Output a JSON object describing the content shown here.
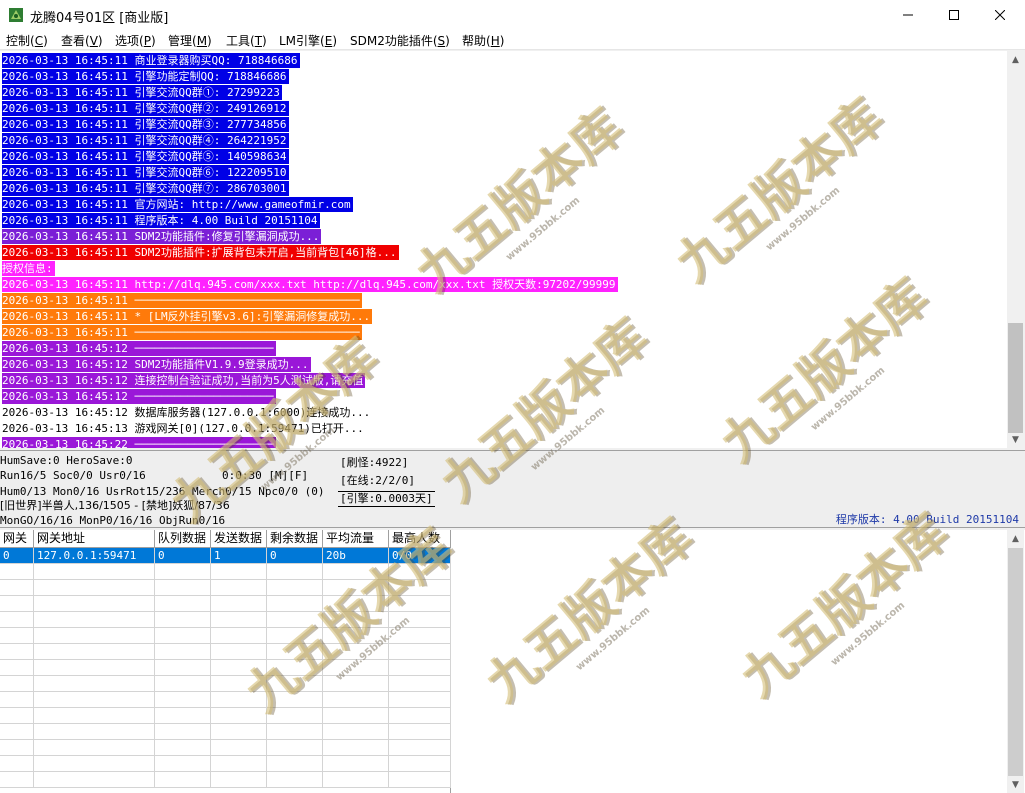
{
  "window": {
    "title": "龙腾04号01区 [商业版]"
  },
  "menu": [
    {
      "label": "控制(",
      "key": "C",
      "end": ")"
    },
    {
      "label": "查看(",
      "key": "V",
      "end": ")"
    },
    {
      "label": "选项(",
      "key": "P",
      "end": ")"
    },
    {
      "label": "管理(",
      "key": "M",
      "end": ")"
    },
    {
      "label": "工具(",
      "key": "T",
      "end": ")"
    },
    {
      "label": "LM引擎(",
      "key": "E",
      "end": ")"
    },
    {
      "label": "SDM2功能插件(",
      "key": "S",
      "end": ")"
    },
    {
      "label": "帮助(",
      "key": "H",
      "end": ")"
    }
  ],
  "colors": {
    "blue": "#0000e6",
    "purple": "#7b1fd6",
    "red": "#f00000",
    "magenta": "#ff22ff",
    "orange": "#ff7a0a",
    "violet": "#9a17d8",
    "selection": "#0078d7"
  },
  "log": [
    {
      "text": "2026-03-13 16:45:11 商业登录器购买QQ: 718846686",
      "bg": "#0000e6",
      "fg": "#ffffff"
    },
    {
      "text": "2026-03-13 16:45:11 引擎功能定制QQ: 718846686",
      "bg": "#0000e6",
      "fg": "#ffffff"
    },
    {
      "text": "2026-03-13 16:45:11 引擎交流QQ群①: 27299223",
      "bg": "#0000e6",
      "fg": "#ffffff"
    },
    {
      "text": "2026-03-13 16:45:11 引擎交流QQ群②: 249126912",
      "bg": "#0000e6",
      "fg": "#ffffff"
    },
    {
      "text": "2026-03-13 16:45:11 引擎交流QQ群③: 277734856",
      "bg": "#0000e6",
      "fg": "#ffffff"
    },
    {
      "text": "2026-03-13 16:45:11 引擎交流QQ群④: 264221952",
      "bg": "#0000e6",
      "fg": "#ffffff"
    },
    {
      "text": "2026-03-13 16:45:11 引擎交流QQ群⑤: 140598634",
      "bg": "#0000e6",
      "fg": "#ffffff"
    },
    {
      "text": "2026-03-13 16:45:11 引擎交流QQ群⑥: 122209510",
      "bg": "#0000e6",
      "fg": "#ffffff"
    },
    {
      "text": "2026-03-13 16:45:11 引擎交流QQ群⑦: 286703001",
      "bg": "#0000e6",
      "fg": "#ffffff"
    },
    {
      "text": "2026-03-13 16:45:11 官方网站: http://www.gameofmir.com",
      "bg": "#0000e6",
      "fg": "#ffffff"
    },
    {
      "text": "2026-03-13 16:45:11 程序版本: 4.00 Build 20151104",
      "bg": "#0000e6",
      "fg": "#ffffff"
    },
    {
      "text": "2026-03-13 16:45:11 SDM2功能插件:修复引擎漏洞成功...",
      "bg": "#7b1fd6",
      "fg": "#ffffff"
    },
    {
      "text": "2026-03-13 16:45:11 SDM2功能插件:扩展背包未开启,当前背包[46]格...",
      "bg": "#f00000",
      "fg": "#ffffff"
    },
    {
      "text": "授权信息:",
      "bg": "#ff22ff",
      "fg": "#ffffff"
    },
    {
      "text": "2026-03-13 16:45:11 http://dlq.945.com/xxx.txt http://dlq.945.com/xxx.txt 授权天数:97202/99999",
      "bg": "#ff22ff",
      "fg": "#ffffff"
    },
    {
      "text": "2026-03-13 16:45:11 ──────────────────────────────────",
      "bg": "#ff7a0a",
      "fg": "#ffffff"
    },
    {
      "text": "2026-03-13 16:45:11 * [LM反外挂引擎v3.6]:引擎漏洞修复成功...",
      "bg": "#ff7a0a",
      "fg": "#ffffff"
    },
    {
      "text": "2026-03-13 16:45:11 ──────────────────────────────────",
      "bg": "#ff7a0a",
      "fg": "#ffffff"
    },
    {
      "text": "2026-03-13 16:45:12 ─────────────────────",
      "bg": "#9a17d8",
      "fg": "#ffffff"
    },
    {
      "text": "2026-03-13 16:45:12 SDM2功能插件V1.9.9登录成功...",
      "bg": "#9a17d8",
      "fg": "#ffffff"
    },
    {
      "text": "2026-03-13 16:45:12 连接控制台验证成功,当前为5人测试版,请充值",
      "bg": "#9a17d8",
      "fg": "#ffffff"
    },
    {
      "text": "2026-03-13 16:45:12 ─────────────────────",
      "bg": "#9a17d8",
      "fg": "#ffffff"
    },
    {
      "text": "2026-03-13 16:45:12 数据库服务器(127.0.0.1:6000)连接成功...",
      "bg": "#ffffff",
      "fg": "#000000"
    },
    {
      "text": "2026-03-13 16:45:13 游戏网关[0](127.0.0.1:59471)已打开...",
      "bg": "#ffffff",
      "fg": "#000000"
    },
    {
      "text": "2026-03-13 16:45:22 ─────────────────────",
      "bg": "#9a17d8",
      "fg": "#ffffff"
    }
  ],
  "status": {
    "line1": "HumSave:0 HeroSave:0",
    "line2a": "Run16/5 Soc0/0 Usr0/16",
    "line2b": "0:0:30 [M][F]",
    "line3": "Hum0/13 Mon0/16 UsrRot15/236 Merch0/15 Npc0/0 (0)",
    "line4": "[旧世界]半兽人,136/1505 - [禁地]妖狐/87/36",
    "line5": "MonGO/16/16 MonP0/16/16 ObjRun0/16",
    "refresh": "[刷怪:4922]",
    "online": "[在线:2/2/0]",
    "engine": "[引擎:0.0003天]",
    "version": "程序版本: 4.00 Build 20151104"
  },
  "grid": {
    "headers": [
      "网关",
      "网关地址",
      "队列数据",
      "发送数据",
      "剩余数据",
      "平均流量",
      "最高人数"
    ],
    "rows": [
      [
        "0",
        "127.0.0.1:59471",
        "0",
        "1",
        "0",
        "20b",
        "0/0"
      ]
    ]
  },
  "watermark": {
    "text": "九五版本库",
    "sub": "www.95bbk.com"
  }
}
